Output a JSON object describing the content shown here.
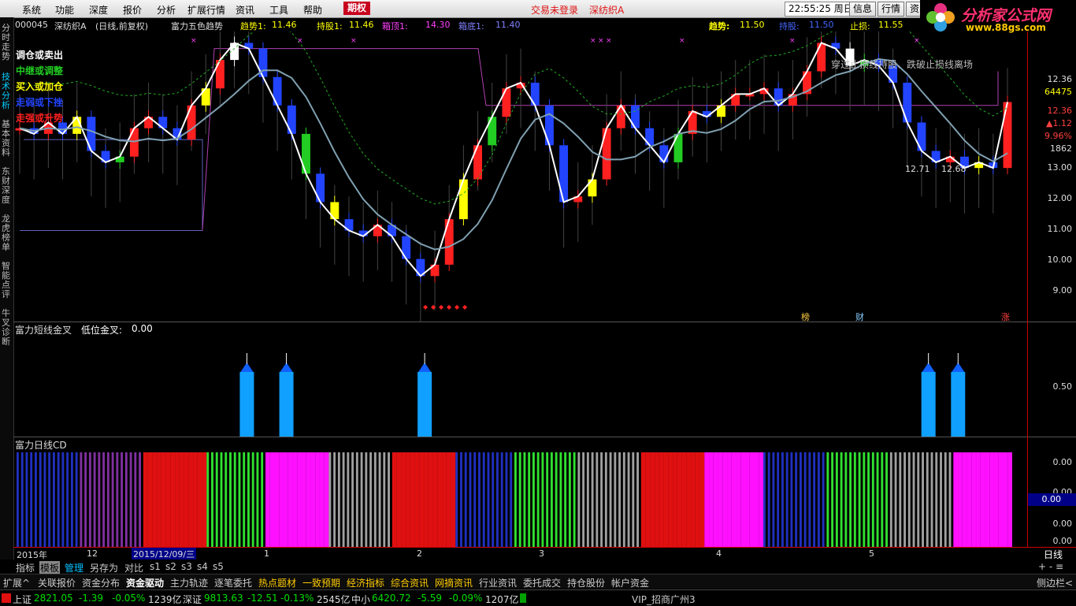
{
  "menu": {
    "items": [
      "系统",
      "功能",
      "深度",
      "报价",
      "分析",
      "扩展行情",
      "资讯",
      "工具",
      "帮助"
    ],
    "qihuo": "期权",
    "login_status": "交易未登录",
    "stock_name_alert": "深纺织A",
    "time": "22:55:25 周日",
    "buttons": [
      "信息",
      "行情",
      "资"
    ]
  },
  "logo": {
    "title": "分析家公式网",
    "url": "www.88gs.com"
  },
  "sidebar": {
    "tabs": [
      "分时走势",
      "技术分析",
      "基本资料",
      "东财深度",
      "龙虎榜单",
      "智能点评",
      "牛叉诊断"
    ]
  },
  "chart_header": {
    "code": "000045",
    "name": "深纺织A",
    "period": "(日线,前复权)",
    "indicator": "富力五色趋势",
    "trend_label": "趋势1:",
    "trend_value": "11.46",
    "hold_label": "持股1:",
    "hold_value": "11.46",
    "box_top_label": "箱顶1:",
    "box_top_value": "14.30",
    "box_bottom_label": "箱底1:",
    "box_bottom_value": "11.40",
    "right_trend_label": "趋势:",
    "right_trend_value": "11.50",
    "right_hold_label": "持股:",
    "right_hold_value": "11.50",
    "stop_label": "止损:",
    "stop_value": "11.55"
  },
  "legend": {
    "items": [
      {
        "text": "调仓或卖出",
        "color": "#ffffff"
      },
      {
        "text": "中继或调整",
        "color": "#22cc22"
      },
      {
        "text": "买入或加仓",
        "color": "#ffff00"
      },
      {
        "text": "走弱或下挫",
        "color": "#2244ff"
      },
      {
        "text": "走强或升势",
        "color": "#ff2020"
      }
    ]
  },
  "annotation": "穿过止损线持股、跌破止损线离场",
  "range_label_a": "12.71",
  "range_label_b": "12.68",
  "markers": {
    "bang": "榜",
    "cai": "财",
    "zhang": "涨"
  },
  "right_panel": {
    "price": "12.36",
    "volume": "64475",
    "high": "12.36",
    "change": "▲1.12",
    "pct": "9.96%",
    "amount": "1862"
  },
  "main_y_labels": [
    "13.00",
    "12.00",
    "11.00",
    "10.00",
    "9.00"
  ],
  "sub1": {
    "title": "富力短线金叉",
    "label": "低位金叉:",
    "value": "0.00",
    "y_label": "0.50"
  },
  "sub2": {
    "title": "富力日线CD",
    "y_labels": [
      "0.00",
      "0.00",
      "0.00",
      "0.00"
    ],
    "highlight": "0.00"
  },
  "x_axis": {
    "labels": [
      "2015年",
      "12",
      "2015/12/09/三",
      "1",
      "2",
      "3",
      "4",
      "5"
    ],
    "right": "日线"
  },
  "tabbar1": {
    "items": [
      "指标",
      "模板",
      "管理",
      "另存为",
      "对比",
      "s1",
      "s2",
      "s3",
      "s4",
      "s5"
    ],
    "right": "+ - ≡"
  },
  "tabbar2": {
    "items": [
      "扩展^",
      "关联报价",
      "资金分布",
      "资金驱动",
      "主力轨迹",
      "逐笔委托",
      "热点题材",
      "一致预期",
      "经济指标",
      "综合资讯",
      "网摘资讯",
      "行业资讯",
      "委托成交",
      "持仓股份",
      "帐户资金"
    ],
    "right": "侧边栏<"
  },
  "status": {
    "sh_label": "上证",
    "sh_value": "2821.05",
    "sh_change": "-1.39",
    "sh_pct": "-0.05%",
    "sh_amount": "1239亿",
    "sz_label": "深证",
    "sz_value": "9813.63",
    "sz_change": "-12.51",
    "sz_pct": "-0.13%",
    "sz_amount": "2545亿",
    "zx_label": "中小",
    "zx_value": "6420.72",
    "zx_change": "-5.59",
    "zx_pct": "-0.09%",
    "zx_amount": "1207亿",
    "vip": "VIP_招商广州3"
  },
  "colors": {
    "up": "#ff2020",
    "down": "#2244ff",
    "hold": "#ffff00",
    "mid": "#22cc22",
    "sell": "#ffffff",
    "magenta": "#ff00ff",
    "macd_line": "#7fa0b0"
  },
  "chart_data": {
    "type": "candlestick",
    "title": "深纺织A (日线,前复权) 富力五色趋势",
    "ylim": [
      8.5,
      13.6
    ],
    "x_periods": [
      "2015-11",
      "2015-12",
      "2016-01",
      "2016-02",
      "2016-03",
      "2016-04",
      "2016-05"
    ],
    "closes": [
      11.9,
      11.8,
      12.0,
      11.8,
      12.1,
      11.5,
      11.3,
      11.4,
      11.9,
      12.1,
      11.9,
      11.7,
      12.3,
      12.6,
      13.1,
      13.4,
      13.3,
      12.8,
      12.3,
      11.8,
      11.1,
      10.6,
      10.3,
      10.1,
      10.0,
      10.2,
      10.0,
      9.6,
      9.3,
      9.5,
      10.3,
      11.0,
      11.6,
      12.1,
      12.6,
      12.7,
      12.3,
      11.6,
      10.6,
      10.7,
      11.0,
      11.9,
      12.3,
      11.9,
      11.6,
      11.3,
      11.8,
      12.2,
      12.1,
      12.3,
      12.5,
      12.5,
      12.6,
      12.3,
      12.5,
      12.9,
      13.4,
      13.3,
      13.0,
      13.1,
      13.0,
      12.7,
      12.0,
      11.5,
      11.3,
      11.4,
      11.2,
      11.3,
      11.2,
      12.36
    ],
    "signal_bar_positions": [
      0.23,
      0.27,
      0.41,
      0.92,
      0.95
    ],
    "cd_pattern": [
      "blue",
      "purple",
      "red",
      "green",
      "magenta",
      "gray",
      "red",
      "blue",
      "green",
      "gray",
      "red",
      "magenta",
      "blue",
      "green",
      "gray",
      "magenta"
    ]
  }
}
